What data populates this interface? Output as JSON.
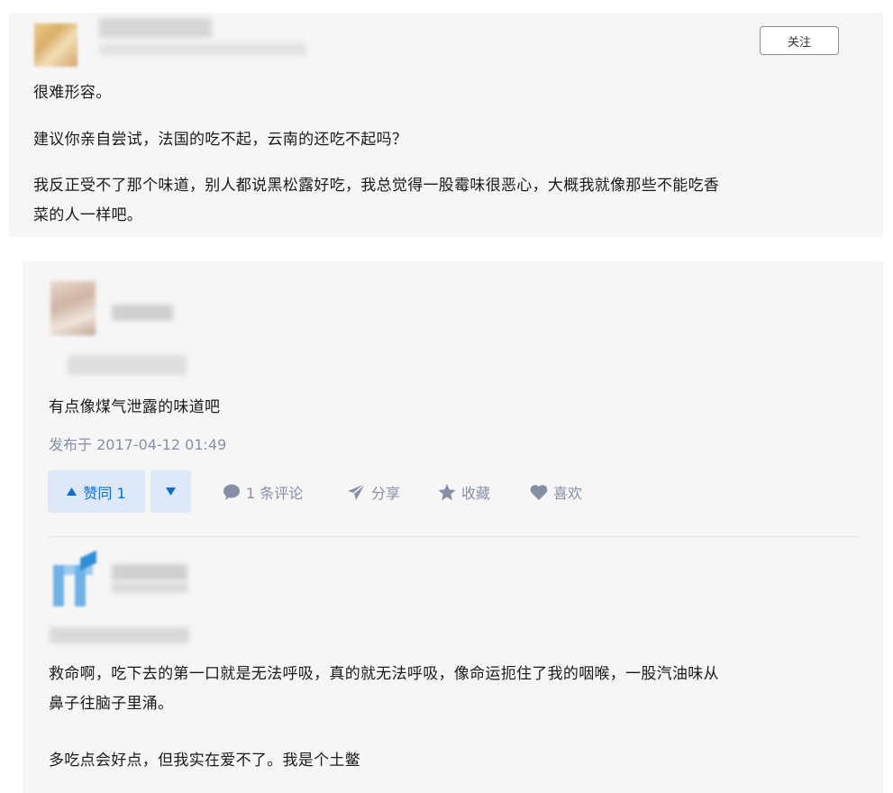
{
  "top_comment": {
    "follow_label": "关注",
    "paragraphs": [
      "很难形容。",
      "建议你亲自尝试，法国的吃不起，云南的还吃不起吗？",
      "我反正受不了那个味道，别人都说黑松露好吃，我总觉得一股霉味很恶心，大概我就像那些不能吃香",
      "菜的人一样吧。"
    ]
  },
  "answer_1": {
    "text": "有点像煤气泄露的味道吧",
    "published": "发布于 2017-04-12 01:49",
    "upvote_label": "赞同 1",
    "actions": {
      "comments": "1 条评论",
      "share": "分享",
      "favorite": "收藏",
      "like": "喜欢"
    }
  },
  "answer_2": {
    "paragraphs": [
      "救命啊，吃下去的第一口就是无法呼吸，真的就无法呼吸，像命运扼住了我的咽喉，一股汽油味从",
      "鼻子往脑子里涌。",
      "多吃点会好点，但我实在爱不了。我是个土鳖"
    ]
  },
  "colors": {
    "accent": "#0a6fd8",
    "vote_bg": "#dde9f8",
    "meta": "#8590a6",
    "card_bg": "#f6f6f6"
  },
  "icons": [
    "caret-up-icon",
    "caret-down-icon",
    "comment-icon",
    "share-icon",
    "star-icon",
    "heart-icon"
  ]
}
